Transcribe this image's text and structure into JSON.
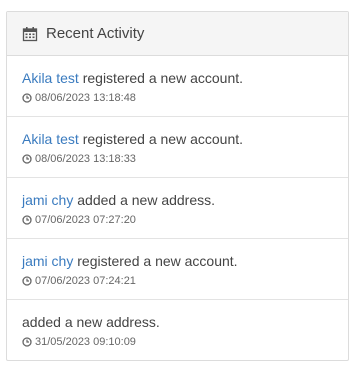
{
  "panel": {
    "title": "Recent Activity",
    "icon": "calendar-icon"
  },
  "activities": [
    {
      "user": "Akila test",
      "action": "registered a new account.",
      "timestamp": "08/06/2023 13:18:48"
    },
    {
      "user": "Akila test",
      "action": "registered a new account.",
      "timestamp": "08/06/2023 13:18:33"
    },
    {
      "user": "jami chy",
      "action": "added a new address.",
      "timestamp": "07/06/2023 07:27:20"
    },
    {
      "user": "jami chy",
      "action": "registered a new account.",
      "timestamp": "07/06/2023 07:24:21"
    },
    {
      "user": "",
      "action": "added a new address.",
      "timestamp": "31/05/2023 09:10:09"
    }
  ],
  "colors": {
    "link": "#3a7bbf",
    "text": "#444444",
    "header_bg": "#f5f5f5",
    "border": "#dcdcdc"
  }
}
